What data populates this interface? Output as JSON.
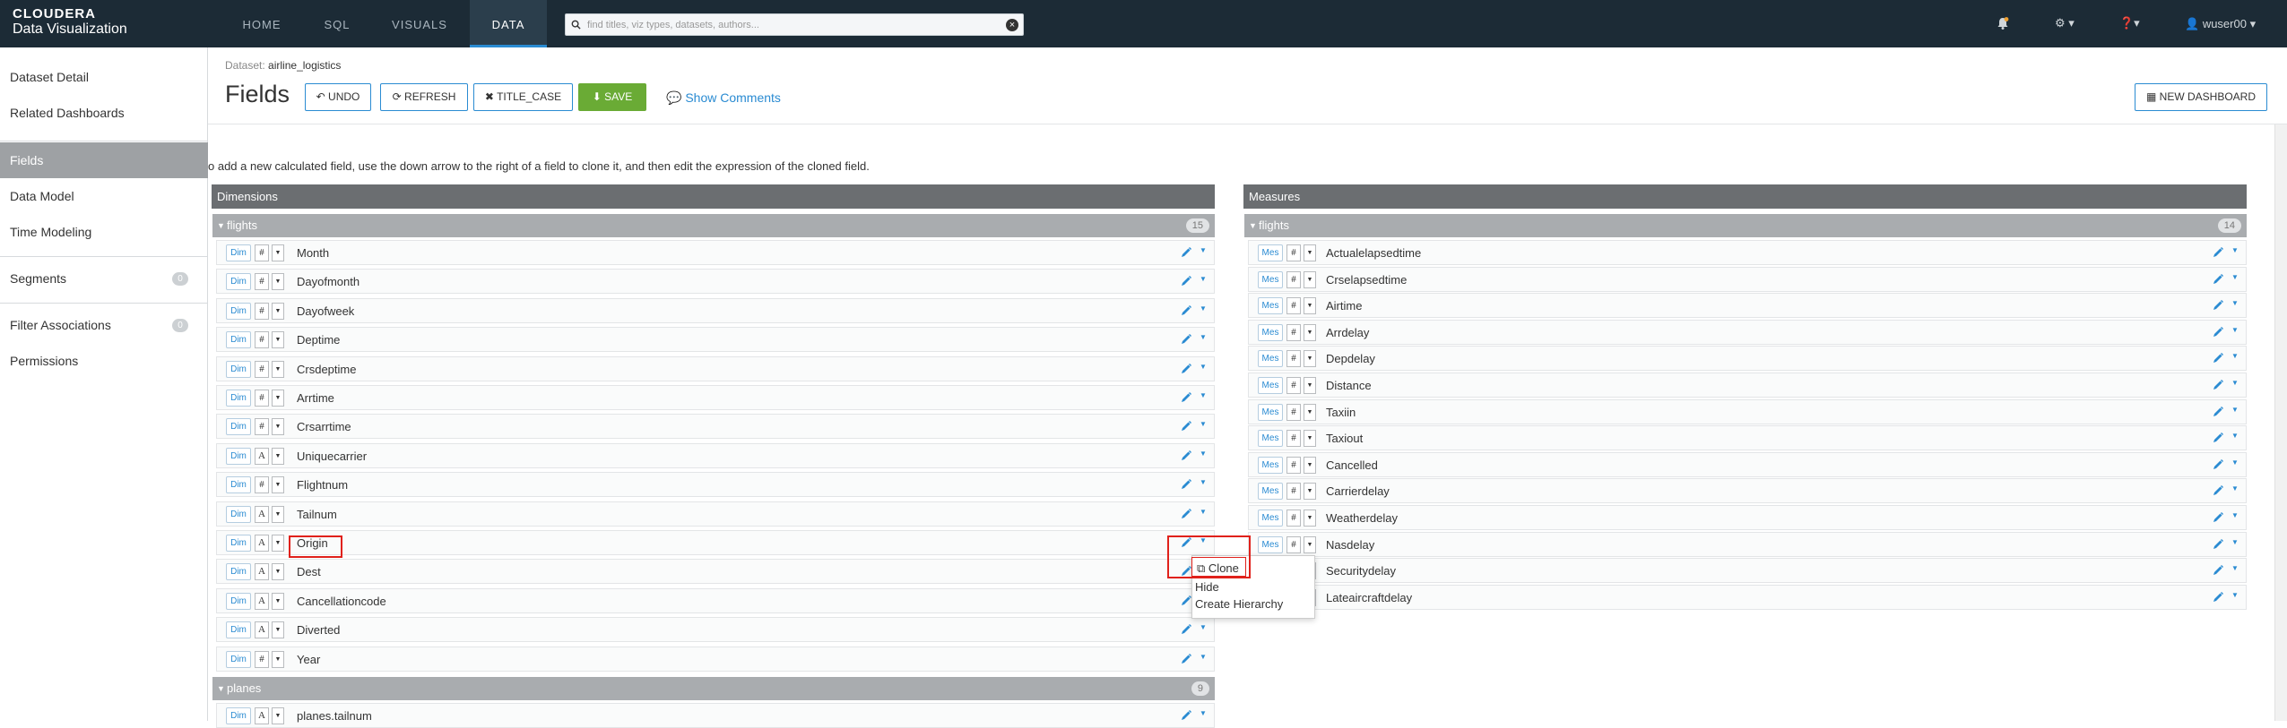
{
  "app": {
    "brand_line1": "CLOUDERA",
    "brand_line2": "Data Visualization"
  },
  "nav": {
    "tabs": [
      "HOME",
      "SQL",
      "VISUALS",
      "DATA"
    ],
    "active": "DATA",
    "search_placeholder": "find titles, viz types, datasets, authors...",
    "user": "wuser00"
  },
  "sidebar": {
    "items": [
      {
        "label": "Dataset Detail",
        "count": ""
      },
      {
        "label": "Related Dashboards",
        "count": ""
      },
      {
        "label": "Fields",
        "count": ""
      },
      {
        "label": "Data Model",
        "count": ""
      },
      {
        "label": "Time Modeling",
        "count": ""
      },
      {
        "label": "Segments",
        "count": "0"
      },
      {
        "label": "Filter Associations",
        "count": "0"
      },
      {
        "label": "Permissions",
        "count": ""
      }
    ],
    "active": "Fields"
  },
  "header": {
    "dataset_key": "Dataset:",
    "dataset_name": "airline_logistics",
    "title": "Fields",
    "undo": "UNDO",
    "refresh": "REFRESH",
    "title_case": "TITLE_CASE",
    "save": "SAVE",
    "show_comments": "Show Comments",
    "new_dashboard": "NEW DASHBOARD"
  },
  "hint": "o add a new calculated field, use the down arrow to the right of a field to clone it, and then edit the expression of the cloned field.",
  "dimensions": {
    "title": "Dimensions",
    "groups": [
      {
        "name": "flights",
        "count": "15",
        "fields": [
          {
            "tag": "Dim",
            "type": "#",
            "name": "Month"
          },
          {
            "tag": "Dim",
            "type": "#",
            "name": "Dayofmonth"
          },
          {
            "tag": "Dim",
            "type": "#",
            "name": "Dayofweek"
          },
          {
            "tag": "Dim",
            "type": "#",
            "name": "Deptime"
          },
          {
            "tag": "Dim",
            "type": "#",
            "name": "Crsdeptime"
          },
          {
            "tag": "Dim",
            "type": "#",
            "name": "Arrtime"
          },
          {
            "tag": "Dim",
            "type": "#",
            "name": "Crsarrtime"
          },
          {
            "tag": "Dim",
            "type": "A",
            "name": "Uniquecarrier"
          },
          {
            "tag": "Dim",
            "type": "#",
            "name": "Flightnum"
          },
          {
            "tag": "Dim",
            "type": "A",
            "name": "Tailnum"
          },
          {
            "tag": "Dim",
            "type": "A",
            "name": "Origin"
          },
          {
            "tag": "Dim",
            "type": "A",
            "name": "Dest"
          },
          {
            "tag": "Dim",
            "type": "A",
            "name": "Cancellationcode"
          },
          {
            "tag": "Dim",
            "type": "A",
            "name": "Diverted"
          },
          {
            "tag": "Dim",
            "type": "#",
            "name": "Year"
          }
        ]
      },
      {
        "name": "planes",
        "count": "9",
        "fields": [
          {
            "tag": "Dim",
            "type": "A",
            "name": "planes.tailnum"
          }
        ]
      }
    ]
  },
  "measures": {
    "title": "Measures",
    "groups": [
      {
        "name": "flights",
        "count": "14",
        "fields": [
          {
            "tag": "Mes",
            "type": "#",
            "name": "Actualelapsedtime"
          },
          {
            "tag": "Mes",
            "type": "#",
            "name": "Crselapsedtime"
          },
          {
            "tag": "Mes",
            "type": "#",
            "name": "Airtime"
          },
          {
            "tag": "Mes",
            "type": "#",
            "name": "Arrdelay"
          },
          {
            "tag": "Mes",
            "type": "#",
            "name": "Depdelay"
          },
          {
            "tag": "Mes",
            "type": "#",
            "name": "Distance"
          },
          {
            "tag": "Mes",
            "type": "#",
            "name": "Taxiin"
          },
          {
            "tag": "Mes",
            "type": "#",
            "name": "Taxiout"
          },
          {
            "tag": "Mes",
            "type": "#",
            "name": "Cancelled"
          },
          {
            "tag": "Mes",
            "type": "#",
            "name": "Carrierdelay"
          },
          {
            "tag": "Mes",
            "type": "#",
            "name": "Weatherdelay"
          },
          {
            "tag": "Mes",
            "type": "#",
            "name": "Nasdelay"
          },
          {
            "tag": "Mes",
            "type": "#",
            "name": "Securitydelay"
          },
          {
            "tag": "Mes",
            "type": "#",
            "name": "Lateaircraftdelay"
          }
        ]
      }
    ]
  },
  "context_menu": {
    "items": [
      "Clone",
      "Hide",
      "Create Hierarchy"
    ]
  },
  "colors": {
    "accent": "#2a8bd2",
    "save": "#6aab35",
    "highlight": "#e0211b"
  }
}
